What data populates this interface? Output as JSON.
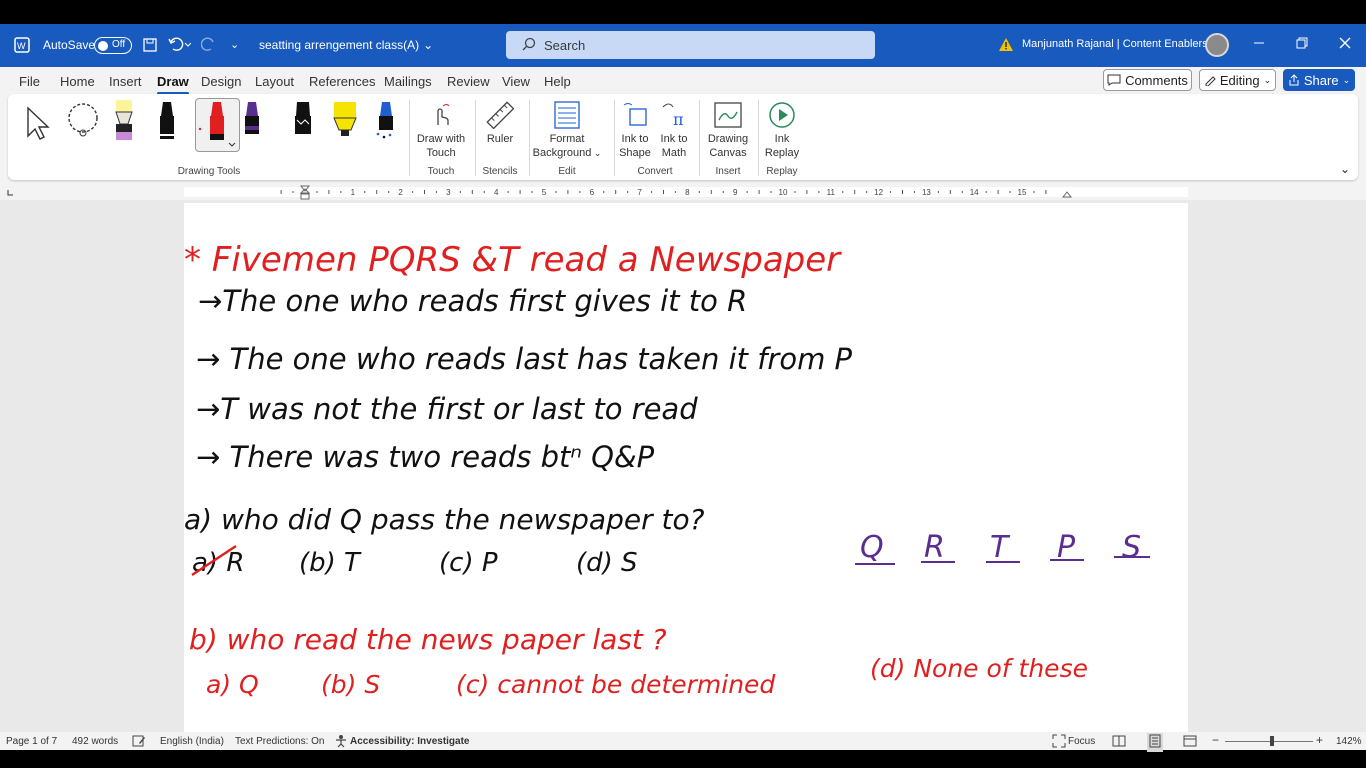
{
  "titlebar": {
    "autosave_label": "AutoSave",
    "autosave_state": "Off",
    "doc_title": "seatting arrengement class(A)",
    "search_placeholder": "Search",
    "user_name": "Manjunath Rajanal | Content Enablers"
  },
  "menu": {
    "tabs": [
      "File",
      "Home",
      "Insert",
      "Draw",
      "Design",
      "Layout",
      "References",
      "Mailings",
      "Review",
      "View",
      "Help"
    ],
    "active_tab": "Draw",
    "comments_label": "Comments",
    "editing_label": "Editing",
    "share_label": "Share"
  },
  "ribbon": {
    "drawing_tools_label": "Drawing Tools",
    "draw_with_touch": [
      "Draw with",
      "Touch"
    ],
    "touch_group": "Touch",
    "ruler": "Ruler",
    "stencils_group": "Stencils",
    "format_background": [
      "Format",
      "Background"
    ],
    "edit_group": "Edit",
    "ink_to_shape": [
      "Ink to",
      "Shape"
    ],
    "ink_to_math": [
      "Ink to",
      "Math"
    ],
    "convert_group": "Convert",
    "drawing_canvas": [
      "Drawing",
      "Canvas"
    ],
    "insert_group": "Insert",
    "ink_replay": [
      "Ink",
      "Replay"
    ],
    "replay_group": "Replay",
    "pen_colors": [
      "#e8e4d8",
      "#111111",
      "#e02020",
      "#5a2d91",
      "#111111",
      "#f5e400",
      "#1f5fd1"
    ]
  },
  "ruler": {
    "numbers": [
      "1",
      "2",
      "3",
      "4",
      "5",
      "6",
      "7",
      "8",
      "9",
      "10",
      "11",
      "12",
      "13",
      "14",
      "15"
    ]
  },
  "document": {
    "title_line": "* Fivemen  PQRS &T read a Newspaper",
    "clue1": "→The one who reads first gives it to R",
    "clue2": "→ The one who reads last has taken it from P",
    "clue3": "→T was not the first  or last to read",
    "clue4": "→ There was  two reads btⁿ Q&P",
    "qa": "a) who did  Q  pass the newspaper to?",
    "qa_opt_a": "a) R",
    "qa_opt_b": "(b) T",
    "qa_opt_c": "(c) P",
    "qa_opt_d": "(d) S",
    "order": [
      "Q",
      "R",
      "T",
      "P",
      "S"
    ],
    "qb": "b) who read  the news paper last ?",
    "qb_opt_a": "a) Q",
    "qb_opt_b": "(b) S",
    "qb_opt_c": "(c) cannot be determined",
    "qb_opt_d": "(d) None of these"
  },
  "status": {
    "page": "Page 1 of 7",
    "words": "492 words",
    "language": "English (India)",
    "predictions": "Text Predictions: On",
    "accessibility": "Accessibility: Investigate",
    "focus": "Focus",
    "zoom": "142%"
  }
}
